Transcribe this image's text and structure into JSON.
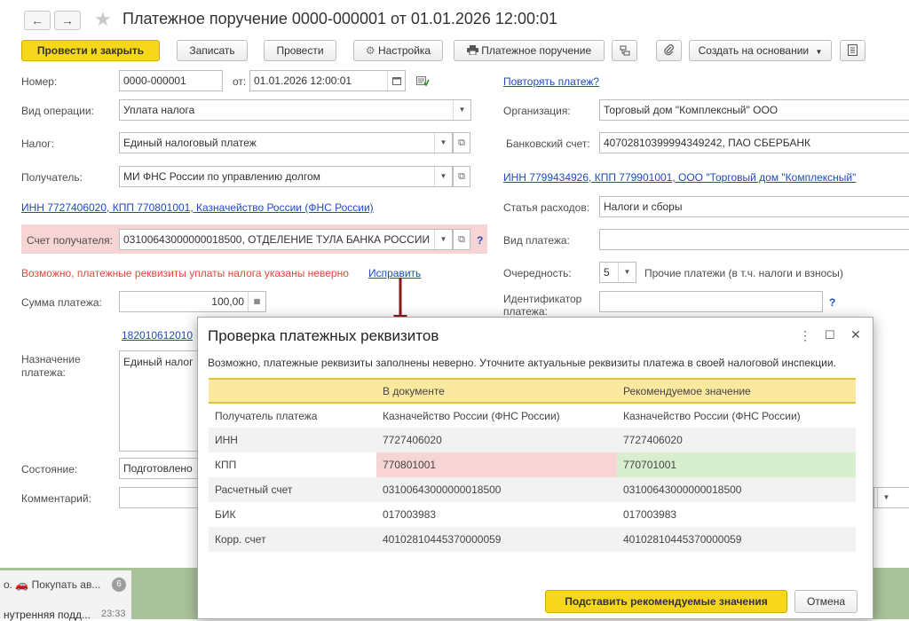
{
  "header": {
    "title": "Платежное поручение 0000-000001 от 01.01.2026 12:00:01",
    "back_glyph": "←",
    "forward_glyph": "→",
    "star_glyph": "★"
  },
  "toolbar": {
    "post_close": "Провести и закрыть",
    "save": "Записать",
    "post": "Провести",
    "settings": "Настройка",
    "print_label": "Платежное поручение",
    "create_based": "Создать на основании"
  },
  "form": {
    "number_label": "Номер:",
    "number_value": "0000-000001",
    "date_label": "от:",
    "date_value": "01.01.2026 12:00:01",
    "repeat_link": "Повторять платеж?",
    "operation_label": "Вид операции:",
    "operation_value": "Уплата налога",
    "org_label": "Организация:",
    "org_value": "Торговый дом \"Комплексный\" ООО",
    "tax_label": "Налог:",
    "tax_value": "Единый налоговый платеж",
    "bank_label": "Банковский счет:",
    "bank_value": "40702810399994349242, ПАО СБЕРБАНК",
    "recipient_label": "Получатель:",
    "recipient_value": "МИ ФНС России по управлению долгом",
    "org_inn_link": "ИНН 7799434926, КПП 779901001, ООО \"Торговый дом \"Комплексный\"",
    "recipient_inn_link": "ИНН 7727406020, КПП 770801001, Казначейство России (ФНС России)",
    "expense_label": "Статья расходов:",
    "expense_value": "Налоги и сборы",
    "account_label": "Счет получателя:",
    "account_value": "03100643000000018500, ОТДЕЛЕНИЕ ТУЛА БАНКА РОССИИ",
    "payment_type_label": "Вид платежа:",
    "payment_type_value": "",
    "warning_text": "Возможно, платежные реквизиты уплаты налога указаны неверно",
    "fix_link": "Исправить",
    "priority_label": "Очередность:",
    "priority_value": "5",
    "priority_desc": "Прочие платежи (в т.ч. налоги и взносы)",
    "amount_label": "Сумма платежа:",
    "amount_value": "100,00",
    "identifier_label": "Идентификатор",
    "identifier_label2": "платежа:",
    "kbk_link": "182010612010",
    "purpose_label": "Назначение",
    "purpose_label2": "платежа:",
    "purpose_value": "Единый налог",
    "state_label": "Состояние:",
    "state_value": "Подготовлено",
    "comment_label": "Комментарий:",
    "question": "?"
  },
  "taskbar": {
    "chat_preview": "о. 🚗 Покупать ав...",
    "badge": "6",
    "chat2": "нутренняя подд...",
    "time": "23:33"
  },
  "dialog": {
    "title": "Проверка платежных реквизитов",
    "note": "Возможно, платежные реквизиты заполнены неверно. Уточните актуальные реквизиты платежа в своей налоговой инспекции.",
    "col_doc": "В документе",
    "col_rec": "Рекомендуемое значение",
    "rows": [
      {
        "name": "Получатель платежа",
        "doc": "Казначейство России (ФНС России)",
        "rec": "Казначейство России (ФНС России)",
        "state": "same"
      },
      {
        "name": "ИНН",
        "doc": "7727406020",
        "rec": "7727406020",
        "state": "same"
      },
      {
        "name": "КПП",
        "doc": "770801001",
        "rec": "770701001",
        "state": "diff"
      },
      {
        "name": "Расчетный счет",
        "doc": "03100643000000018500",
        "rec": "03100643000000018500",
        "state": "same"
      },
      {
        "name": "БИК",
        "doc": "017003983",
        "rec": "017003983",
        "state": "same"
      },
      {
        "name": "Корр. счет",
        "doc": "40102810445370000059",
        "rec": "40102810445370000059",
        "state": "same"
      }
    ],
    "apply_button": "Подставить рекомендуемые значения",
    "cancel_button": "Отмена",
    "more_glyph": "⋮",
    "max_glyph": "☐",
    "close_glyph": "✕"
  },
  "colors": {
    "primary_button": "#f6d71c",
    "error_text": "#e4473a",
    "link": "#1e4bbf",
    "mismatch_bg": "#f8d5d5",
    "recommended_bg": "#d8efcf",
    "arrow": "#8b1a1a"
  }
}
